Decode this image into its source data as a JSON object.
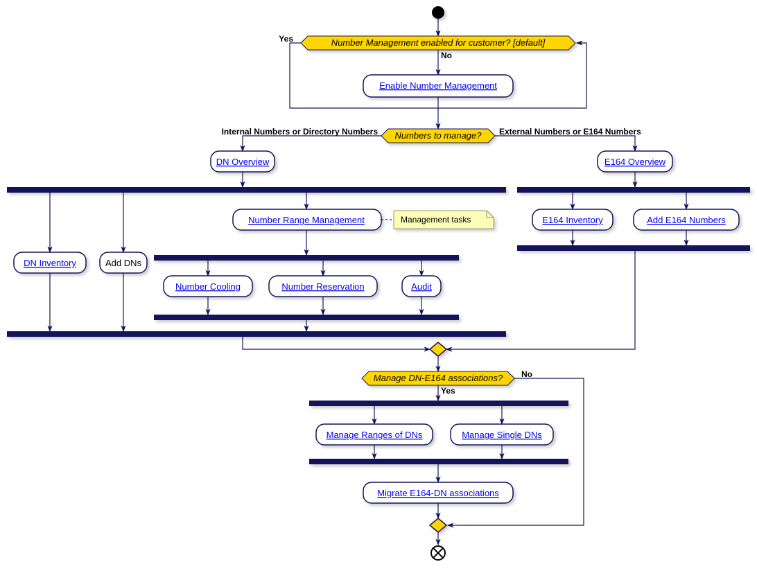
{
  "decisions": {
    "d1": "Number Management enabled for customer? [default]",
    "d1_yes": "Yes",
    "d1_no": "No",
    "d2": "Numbers to manage?",
    "d2_left": "Internal Numbers or Directory Numbers",
    "d2_right": "External Numbers or E164 Numbers",
    "d3": "Manage DN-E164 associations?",
    "d3_yes": "Yes",
    "d3_no": "No"
  },
  "activities": {
    "enable_nm": "Enable Number Management",
    "dn_overview": "DN Overview",
    "e164_overview": "E164 Overview",
    "dn_inventory": "DN Inventory",
    "add_dns": "Add DNs",
    "nrm": "Number Range Management",
    "number_cooling": "Number Cooling",
    "number_reservation": "Number Reservation",
    "audit": "Audit",
    "e164_inventory": "E164 Inventory",
    "add_e164": "Add E164 Numbers",
    "manage_ranges": "Manage Ranges of DNs",
    "manage_single": "Manage Single DNs",
    "migrate": "Migrate E164-DN associations"
  },
  "notes": {
    "mgmt_tasks": "Management tasks"
  }
}
